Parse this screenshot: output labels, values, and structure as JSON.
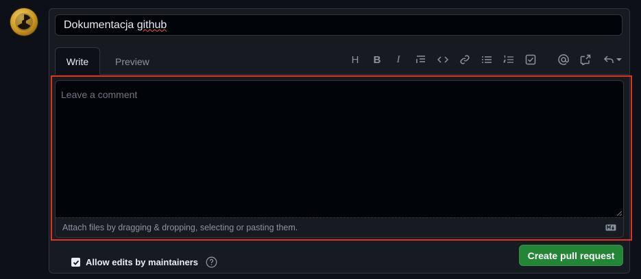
{
  "title_input": {
    "value_main": "Dokumentacja ",
    "value_misspelled": "github"
  },
  "tabs": {
    "write": "Write",
    "preview": "Preview"
  },
  "toolbar": {
    "heading": "H",
    "bold": "B",
    "italic": "I"
  },
  "comment": {
    "placeholder": "Leave a comment"
  },
  "attach": {
    "text": "Attach files by dragging & dropping, selecting or pasting them."
  },
  "allow_edits": {
    "label": "Allow edits by maintainers",
    "checked": true
  },
  "buttons": {
    "create_pr": "Create pull request"
  },
  "colors": {
    "accent_green": "#238636",
    "highlight_red": "#e5321f",
    "bg": "#0d1117"
  }
}
